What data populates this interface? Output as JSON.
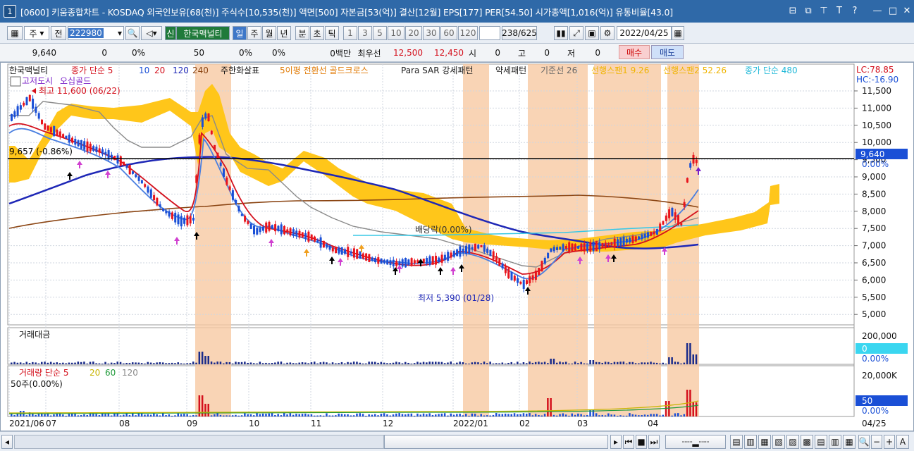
{
  "window": {
    "number": "1",
    "title": "[0600] 키움종합차트 - KOSDAQ 외국인보유[68(천)] 주식수[10,535(천)] 액면[500] 자본금[53(억)] 결산[12월] EPS[177] PER[54.50] 시가총액[1,016(억)] 유통비율[43.0]",
    "buttons": [
      "⊟",
      "⧉",
      "⊤",
      "T",
      "?",
      "—",
      "□",
      "✕"
    ]
  },
  "toolbar": {
    "period_type": "주",
    "prev_label": "전",
    "code": "222980",
    "credit_label": "신",
    "stock_name": "한국맥널티",
    "period_buttons": [
      "일",
      "주",
      "월",
      "년",
      "분",
      "초",
      "틱"
    ],
    "intervals": [
      "1",
      "3",
      "5",
      "10",
      "20",
      "30",
      "60",
      "120"
    ],
    "count": "238",
    "total": "/625",
    "date": "2022/04/25"
  },
  "quote": {
    "price": "9,640",
    "change": "0",
    "change_pct": "0%",
    "volume": "50",
    "vol_pct": "0%",
    "vol_pct2": "0%",
    "amount": "0백만",
    "best_label": "최우선",
    "ask": "12,500",
    "bid": "12,450",
    "open_label": "시",
    "open": "0",
    "high_label": "고",
    "high": "0",
    "low_label": "저",
    "low": "0",
    "buy_label": "매수",
    "sell_label": "매도"
  },
  "legend": {
    "name": "한국맥널티",
    "ma_label": "종가 단순 5",
    "ma10": "10",
    "ma20": "20",
    "ma120": "120",
    "ma240": "240",
    "juhan": "주한화살표",
    "golden": "5이평 전환선 골드크로스",
    "parasar": "Para SAR 강세패턴",
    "weak": "약세패턴",
    "base": "기준선 26",
    "span1": "선행스팬1 9.26",
    "span2": "선행스팬2 52.26",
    "ma480": "종가 단순 480",
    "lc": "LC:78.85",
    "hc": "HC:-16.90",
    "gojeo": "고저도시",
    "ojup": "오십골드",
    "high_note": "최고 11,600 (06/22)",
    "low_note": "최저 5,390 (01/28)",
    "cur_note": "9,657 (-0.86%)",
    "dividend": "배당락(0.00%)"
  },
  "price_axis": [
    "11,500",
    "11,000",
    "10,500",
    "10,000",
    "9,500",
    "9,000",
    "8,500",
    "8,000",
    "7,500",
    "7,000",
    "6,500",
    "6,000",
    "5,500",
    "5,000"
  ],
  "cur_price_box": "9,640",
  "cur_pct": "0.00%",
  "amount_panel": {
    "label": "거래대금",
    "axis_top": "200,000",
    "box": "0",
    "pct": "0.00%"
  },
  "volume_panel": {
    "label": "거래량 단순 5",
    "ma20": "20",
    "ma60": "60",
    "ma120": "120",
    "sub": "50주(0.00%)",
    "axis_top": "20,000K",
    "box": "50",
    "pct": "0.00%"
  },
  "x_axis": [
    "2021/06",
    "07",
    "08",
    "09",
    "10",
    "11",
    "12",
    "2022/01",
    "02",
    "03",
    "04"
  ],
  "x_end": "04/25",
  "colors": {
    "title": "#2f69a8",
    "cloud": "#ffc61a",
    "shade": "#f7c9a3",
    "ma120": "#1e27b6",
    "ma240": "#8b4513",
    "up": "#e8141c",
    "down": "#1a4fd6"
  }
}
